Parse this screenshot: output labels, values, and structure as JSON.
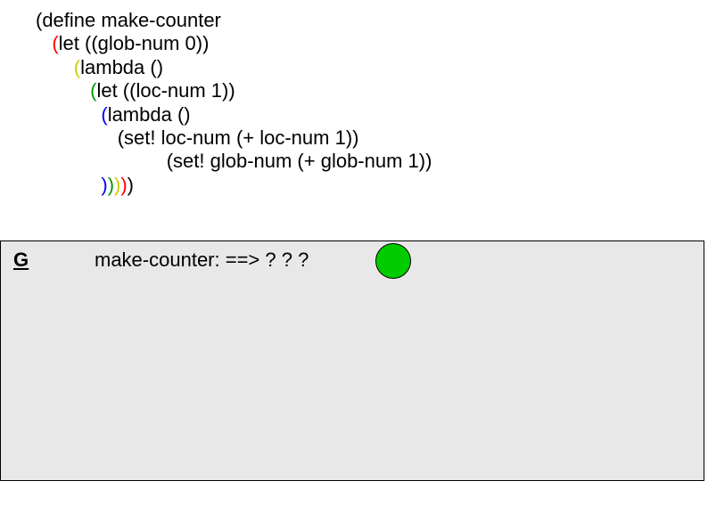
{
  "code": {
    "l1a": "(define make-counter",
    "l2a": "(",
    "l2b": "let ((glob-num 0))",
    "l3a": "(",
    "l3b": "lambda ()",
    "l4a": "(",
    "l4b": "let ((loc-num 1))",
    "l5a": "(",
    "l5b": "lambda ()",
    "l6": "(set! loc-num (+ loc-num 1))",
    "l7": "(set! glob-num (+ glob-num 1))",
    "l8_blue": ")",
    "l8_green": ")",
    "l8_yellow": ")",
    "l8_red": ")",
    "l8_black": ")"
  },
  "env": {
    "label": "G",
    "text": "make-counter: ==> ? ? ?"
  },
  "indent": {
    "l1": "",
    "l2": "   ",
    "l3": "       ",
    "l4": "          ",
    "l5": "            ",
    "l6": "               ",
    "l7": "                        ",
    "l8": "            "
  }
}
